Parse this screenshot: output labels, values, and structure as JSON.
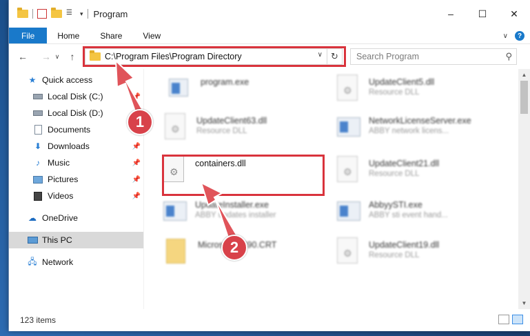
{
  "window": {
    "title": "Program",
    "controls": {
      "minimize": "–",
      "maximize": "☐",
      "close": "✕"
    }
  },
  "ribbon": {
    "tabs": [
      "File",
      "Home",
      "Share",
      "View"
    ],
    "expand": "∨",
    "help": "?"
  },
  "nav": {
    "back": "←",
    "forward": "→",
    "recent": "∨",
    "up": "↑",
    "address": "C:\\Program Files\\Program Directory",
    "dropdown": "∨",
    "refresh": "↻",
    "search_placeholder": "Search Program",
    "search_icon": "⚲"
  },
  "sidebar": {
    "quick_access": "Quick access",
    "items": [
      {
        "label": "Local Disk (C:)",
        "icon": "drive-icon"
      },
      {
        "label": "Local Disk (D:)",
        "icon": "drive-icon"
      },
      {
        "label": "Documents",
        "icon": "documents-icon"
      },
      {
        "label": "Downloads",
        "icon": "downloads-icon"
      },
      {
        "label": "Music",
        "icon": "music-icon"
      },
      {
        "label": "Pictures",
        "icon": "pictures-icon"
      },
      {
        "label": "Videos",
        "icon": "videos-icon"
      }
    ],
    "onedrive": "OneDrive",
    "this_pc": "This PC",
    "network": "Network"
  },
  "files": [
    {
      "name": "program.exe",
      "desc": "",
      "icon": "exe",
      "blur": true
    },
    {
      "name": "UpdateClient5.dll",
      "desc": "Resource DLL",
      "icon": "dll",
      "blur": true
    },
    {
      "name": "UpdateClient63.dll",
      "desc": "Resource DLL",
      "icon": "dll",
      "blur": true
    },
    {
      "name": "NetworkLicenseServer.exe",
      "desc": "ABBY network licens...",
      "icon": "exe",
      "blur": true
    },
    {
      "name": "containers.dll",
      "desc": "",
      "icon": "dll",
      "blur": false
    },
    {
      "name": "UpdateClient21.dll",
      "desc": "Resource DLL",
      "icon": "dll",
      "blur": true
    },
    {
      "name": "UpdateInstaller.exe",
      "desc": "ABBY updates installer",
      "icon": "exe",
      "blur": true
    },
    {
      "name": "AbbyySTI.exe",
      "desc": "ABBY sti event hand...",
      "icon": "exe",
      "blur": true
    },
    {
      "name": "Microsoft.VC90.CRT",
      "desc": "",
      "icon": "folder",
      "blur": true
    },
    {
      "name": "UpdateClient19.dll",
      "desc": "Resource DLL",
      "icon": "dll",
      "blur": true
    }
  ],
  "status": {
    "item_count": "123 items"
  },
  "annotations": {
    "step1": "1",
    "step2": "2"
  },
  "colors": {
    "accent": "#1979ca",
    "highlight": "#d9333c",
    "badge": "#d8424a"
  }
}
